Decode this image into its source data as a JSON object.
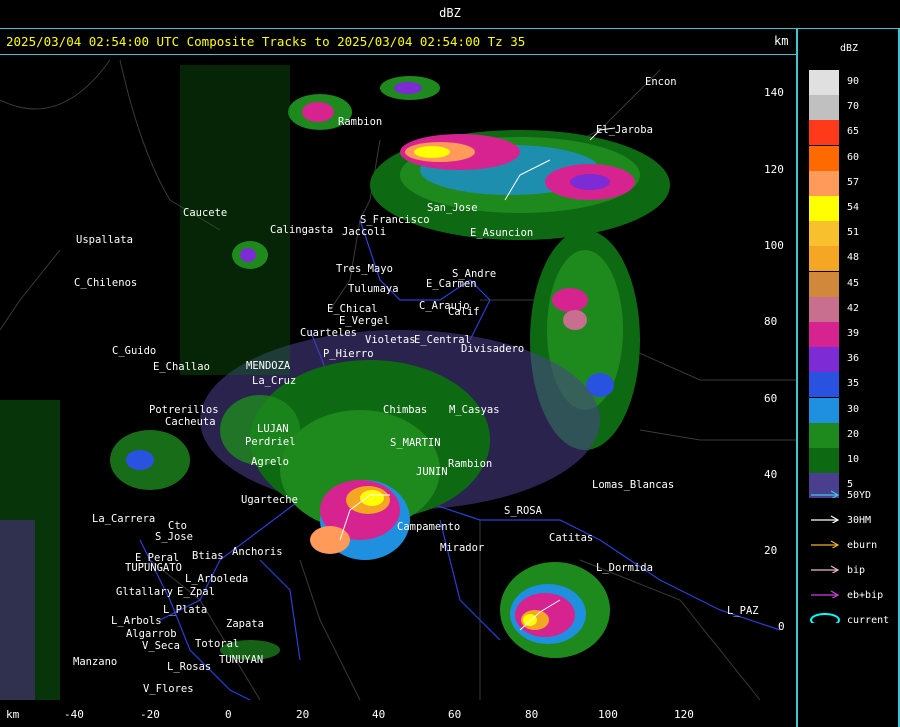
{
  "title_bar": "dBZ",
  "header": "2025/03/04 02:54:00 UTC Composite Tracks to 2025/03/04 02:54:00 Tz 35",
  "axis": {
    "y_unit": "km",
    "x_unit": "km",
    "y_ticks": [
      "140",
      "120",
      "100",
      "80",
      "60",
      "40",
      "20",
      "0"
    ],
    "x_ticks": [
      "-40",
      "-20",
      "0",
      "20",
      "40",
      "60",
      "80",
      "100",
      "120"
    ]
  },
  "legend": {
    "title": "dBZ",
    "scale": [
      {
        "label": "90",
        "color": "#e0e0e0"
      },
      {
        "label": "70",
        "color": "#c0c0c0"
      },
      {
        "label": "65",
        "color": "#ff3a1a"
      },
      {
        "label": "60",
        "color": "#ff6a00"
      },
      {
        "label": "57",
        "color": "#ff9a5a"
      },
      {
        "label": "54",
        "color": "#ffff00"
      },
      {
        "label": "51",
        "color": "#f7c02c"
      },
      {
        "label": "48",
        "color": "#f5a623"
      },
      {
        "label": "45",
        "color": "#d2883a"
      },
      {
        "label": "42",
        "color": "#c86e8e"
      },
      {
        "label": "39",
        "color": "#d7238f"
      },
      {
        "label": "36",
        "color": "#7d2bd4"
      },
      {
        "label": "35",
        "color": "#2a52e0"
      },
      {
        "label": "30",
        "color": "#1f8fe0"
      },
      {
        "label": "20",
        "color": "#1e8a1e"
      },
      {
        "label": "10",
        "color": "#0e6a12"
      },
      {
        "label": "5",
        "color": "#4a3f8e"
      }
    ],
    "tracks": [
      {
        "label": "50YD",
        "color": "#3ec6e6"
      },
      {
        "label": "30HM",
        "color": "#ffffff"
      },
      {
        "label": "eburn",
        "color": "#f0b030"
      },
      {
        "label": "bip",
        "color": "#f0b8d0"
      },
      {
        "label": "eb+bip",
        "color": "#d040e0"
      },
      {
        "label": "current",
        "color": "#00ffff"
      }
    ]
  },
  "places": [
    {
      "name": "Encon",
      "color": "#fff"
    },
    {
      "name": "Rambion",
      "color": "#fff"
    },
    {
      "name": "El_Jaroba",
      "color": "#fff"
    },
    {
      "name": "San_Jose",
      "color": "#fff"
    },
    {
      "name": "Uspallata",
      "color": "#fff"
    },
    {
      "name": "C_Chilenos",
      "color": "#fff"
    },
    {
      "name": "Caucete",
      "color": "#fff"
    },
    {
      "name": "Calingasta",
      "color": "#fff"
    },
    {
      "name": "S_Francisco",
      "color": "#fff"
    },
    {
      "name": "Jaccoli",
      "color": "#fff"
    },
    {
      "name": "E_Asuncion",
      "color": "#fff"
    },
    {
      "name": "Tres_Mayo",
      "color": "#fff"
    },
    {
      "name": "Tulumaya",
      "color": "#fff"
    },
    {
      "name": "S_Andre",
      "color": "#fff"
    },
    {
      "name": "E_Carmen",
      "color": "#fff"
    },
    {
      "name": "E_Chical",
      "color": "#fff"
    },
    {
      "name": "E_Vergel",
      "color": "#fff"
    },
    {
      "name": "C_Araujo",
      "color": "#fff"
    },
    {
      "name": "Calif",
      "color": "#fff"
    },
    {
      "name": "Cuarteles",
      "color": "#fff"
    },
    {
      "name": "P_Hierro",
      "color": "#fff"
    },
    {
      "name": "Violetas",
      "color": "#fff"
    },
    {
      "name": "E_Central",
      "color": "#fff"
    },
    {
      "name": "Divisadero",
      "color": "#fff"
    },
    {
      "name": "C_Guido",
      "color": "#fff"
    },
    {
      "name": "E_Challao",
      "color": "#fff"
    },
    {
      "name": "MENDOZA",
      "color": "#fff"
    },
    {
      "name": "La_Cruz",
      "color": "#fff"
    },
    {
      "name": "Potrerillos",
      "color": "#fff"
    },
    {
      "name": "Cacheuta",
      "color": "#fff"
    },
    {
      "name": "Chimbas",
      "color": "#fff"
    },
    {
      "name": "M_Casyas",
      "color": "#fff"
    },
    {
      "name": "Perdriel",
      "color": "#fff"
    },
    {
      "name": "LUJAN",
      "color": "#fff"
    },
    {
      "name": "S_MARTIN",
      "color": "#fff"
    },
    {
      "name": "Agrelo",
      "color": "#fff"
    },
    {
      "name": "JUNIN",
      "color": "#fff"
    },
    {
      "name": "Rambion",
      "color": "#fff"
    },
    {
      "name": "Lomas_Blancas",
      "color": "#fff"
    },
    {
      "name": "Ugarteche",
      "color": "#fff"
    },
    {
      "name": "La_Carrera",
      "color": "#fff"
    },
    {
      "name": "Cto",
      "color": "#fff"
    },
    {
      "name": "S_Jose",
      "color": "#fff"
    },
    {
      "name": "S_ROSA",
      "color": "#fff"
    },
    {
      "name": "Campamento",
      "color": "#fff"
    },
    {
      "name": "Anchoris",
      "color": "#fff"
    },
    {
      "name": "E_Peral",
      "color": "#fff"
    },
    {
      "name": "Btias",
      "color": "#fff"
    },
    {
      "name": "TUPUNGATO",
      "color": "#fff"
    },
    {
      "name": "Catitas",
      "color": "#fff"
    },
    {
      "name": "Mirador",
      "color": "#fff"
    },
    {
      "name": "L_Arboleda",
      "color": "#fff"
    },
    {
      "name": "L_Dormida",
      "color": "#fff"
    },
    {
      "name": "Gltallary",
      "color": "#fff"
    },
    {
      "name": "E_Zpal",
      "color": "#fff"
    },
    {
      "name": "L_Plata",
      "color": "#fff"
    },
    {
      "name": "L_Arbols",
      "color": "#fff"
    },
    {
      "name": "Zapata",
      "color": "#fff"
    },
    {
      "name": "Algarrob",
      "color": "#fff"
    },
    {
      "name": "V_Seca",
      "color": "#fff"
    },
    {
      "name": "Totoral",
      "color": "#fff"
    },
    {
      "name": "Manzano",
      "color": "#fff"
    },
    {
      "name": "L_Rosas",
      "color": "#fff"
    },
    {
      "name": "TUNUYAN",
      "color": "#fff"
    },
    {
      "name": "V_Flores",
      "color": "#fff"
    },
    {
      "name": "L_PAZ",
      "color": "#fff"
    }
  ],
  "colors": {
    "frame": "#3ec6d0",
    "header": "#ffff00",
    "background": "#000000",
    "boundary": "#2b3fd6"
  }
}
